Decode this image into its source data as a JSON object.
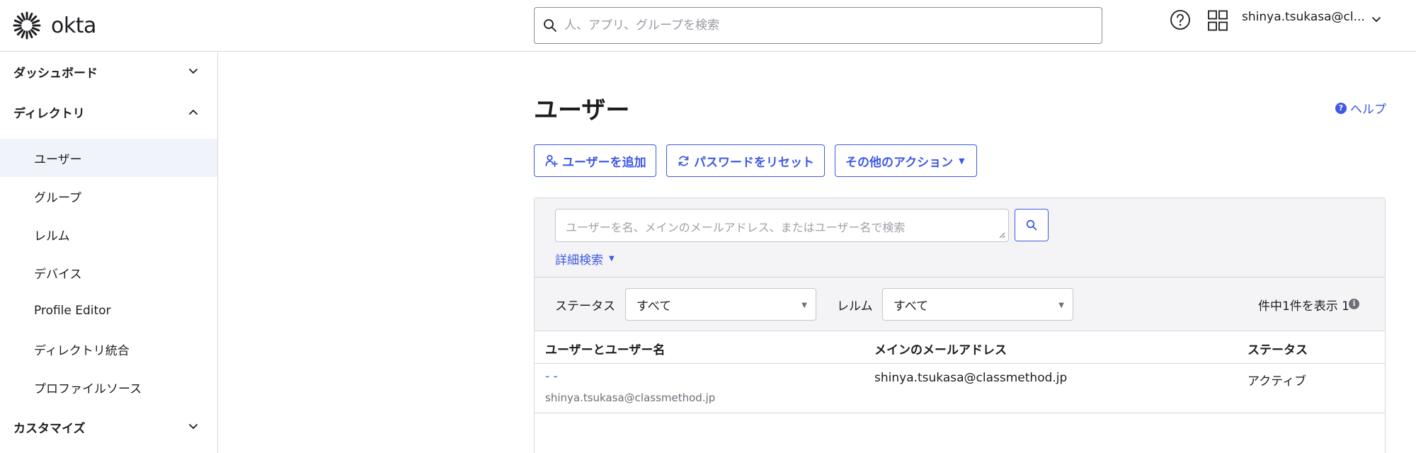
{
  "header": {
    "logo_text": "okta",
    "search_placeholder": "人、アプリ、グループを検索",
    "user_name": "shinya.tsukasa@cl..."
  },
  "sidebar": {
    "sections": [
      {
        "label": "ダッシュボード",
        "expanded": false
      },
      {
        "label": "ディレクトリ",
        "expanded": true
      },
      {
        "label": "カスタマイズ",
        "expanded": false
      }
    ],
    "items": [
      {
        "label": "ユーザー",
        "active": true
      },
      {
        "label": "グループ"
      },
      {
        "label": "レルム"
      },
      {
        "label": "デバイス"
      },
      {
        "label": "Profile Editor"
      },
      {
        "label": "ディレクトリ統合"
      },
      {
        "label": "プロファイルソース"
      }
    ]
  },
  "main": {
    "title": "ユーザー",
    "help_label": "ヘルプ",
    "buttons": {
      "add_user": "ユーザーを追加",
      "reset_password": "パスワードをリセット",
      "more_actions": "その他のアクション"
    },
    "search": {
      "placeholder": "ユーザーを名、メインのメールアドレス、またはユーザー名で検索",
      "advanced_label": "詳細検索"
    },
    "filters": {
      "status_label": "ステータス",
      "status_value": "すべて",
      "realm_label": "レルム",
      "realm_value": "すべて",
      "count_text": "件中1件を表示 1"
    },
    "table": {
      "columns": [
        "ユーザーとユーザー名",
        "メインのメールアドレス",
        "ステータス"
      ],
      "rows": [
        {
          "name": "- -",
          "login": "shinya.tsukasa@classmethod.jp",
          "email": "shinya.tsukasa@classmethod.jp",
          "status": "アクティブ"
        }
      ]
    }
  },
  "colors": {
    "accent": "#3f59e4",
    "active_nav_bg": "#f0f3fa",
    "panel_bg": "#f4f4f6",
    "border": "#d7d7dc"
  }
}
